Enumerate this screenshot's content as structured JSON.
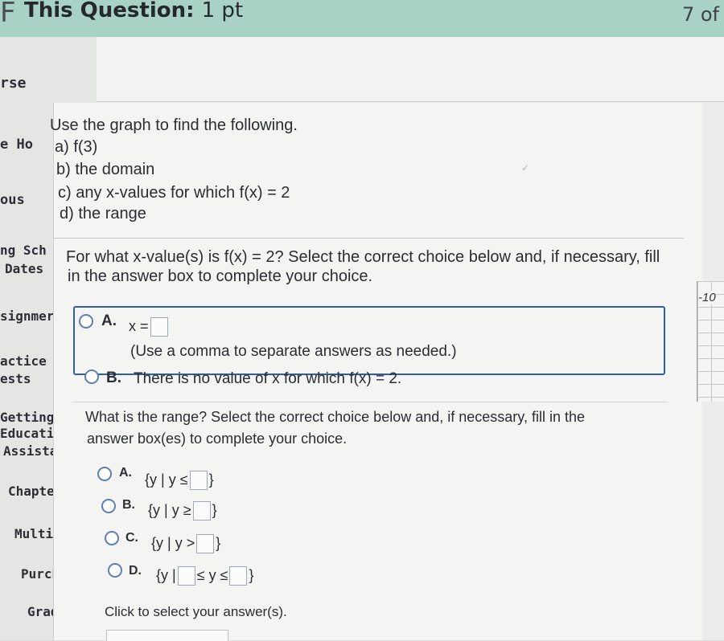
{
  "header": {
    "logo": "F",
    "title": "This Question:",
    "points": "1 pt",
    "pager": "7 of"
  },
  "sidebar": {
    "items": [
      {
        "label": "rse"
      },
      {
        "label": "e Ho"
      },
      {
        "label": "ous"
      },
      {
        "label": "ng Sch"
      },
      {
        "label": "Dates"
      },
      {
        "label": "signmer"
      },
      {
        "label": "actice Te"
      },
      {
        "label": "ests"
      },
      {
        "label": "Getting He"
      },
      {
        "label": "Education"
      },
      {
        "label": "Assistants"
      },
      {
        "label": "Chapter Co"
      },
      {
        "label": "Multimedi"
      },
      {
        "label": "Purchase C"
      },
      {
        "label": "Gradebook"
      }
    ]
  },
  "question": {
    "intro": "Use the graph to find the following.",
    "parts": [
      "a) f(3)",
      "b) the domain",
      "c) any x-values for which f(x) = 2",
      "d) the range"
    ]
  },
  "part_c": {
    "prompt_line1": "For what x-value(s) is f(x) = 2? Select the correct choice below and, if necessary, fill",
    "prompt_line2": "in the answer box to complete your choice.",
    "choice_a_letter": "A.",
    "choice_a_text": "x =",
    "choice_a_note": "(Use a comma to separate answers as needed.)",
    "choice_b_letter": "B.",
    "choice_b_text": "There is no value of x for which f(x) = 2."
  },
  "part_d": {
    "prompt_line1": "What is the range? Select the correct choice below and, if necessary, fill in the",
    "prompt_line2": "answer box(es) to complete your choice.",
    "choices": [
      {
        "letter": "A.",
        "prefix": "{y | y ≤",
        "suffix": "}"
      },
      {
        "letter": "B.",
        "prefix": "{y | y ≥",
        "suffix": "}"
      },
      {
        "letter": "C.",
        "prefix": "{y | y >",
        "suffix": "}"
      },
      {
        "letter": "D.",
        "prefix": "{y |",
        "middle": "≤ y ≤",
        "suffix": "}"
      }
    ]
  },
  "footer": {
    "hint": "Click to select your answer(s)."
  },
  "graph": {
    "tick_label": "-10"
  },
  "colors": {
    "header_bg": "#a9d2c6",
    "accent": "#2e5ea8"
  }
}
